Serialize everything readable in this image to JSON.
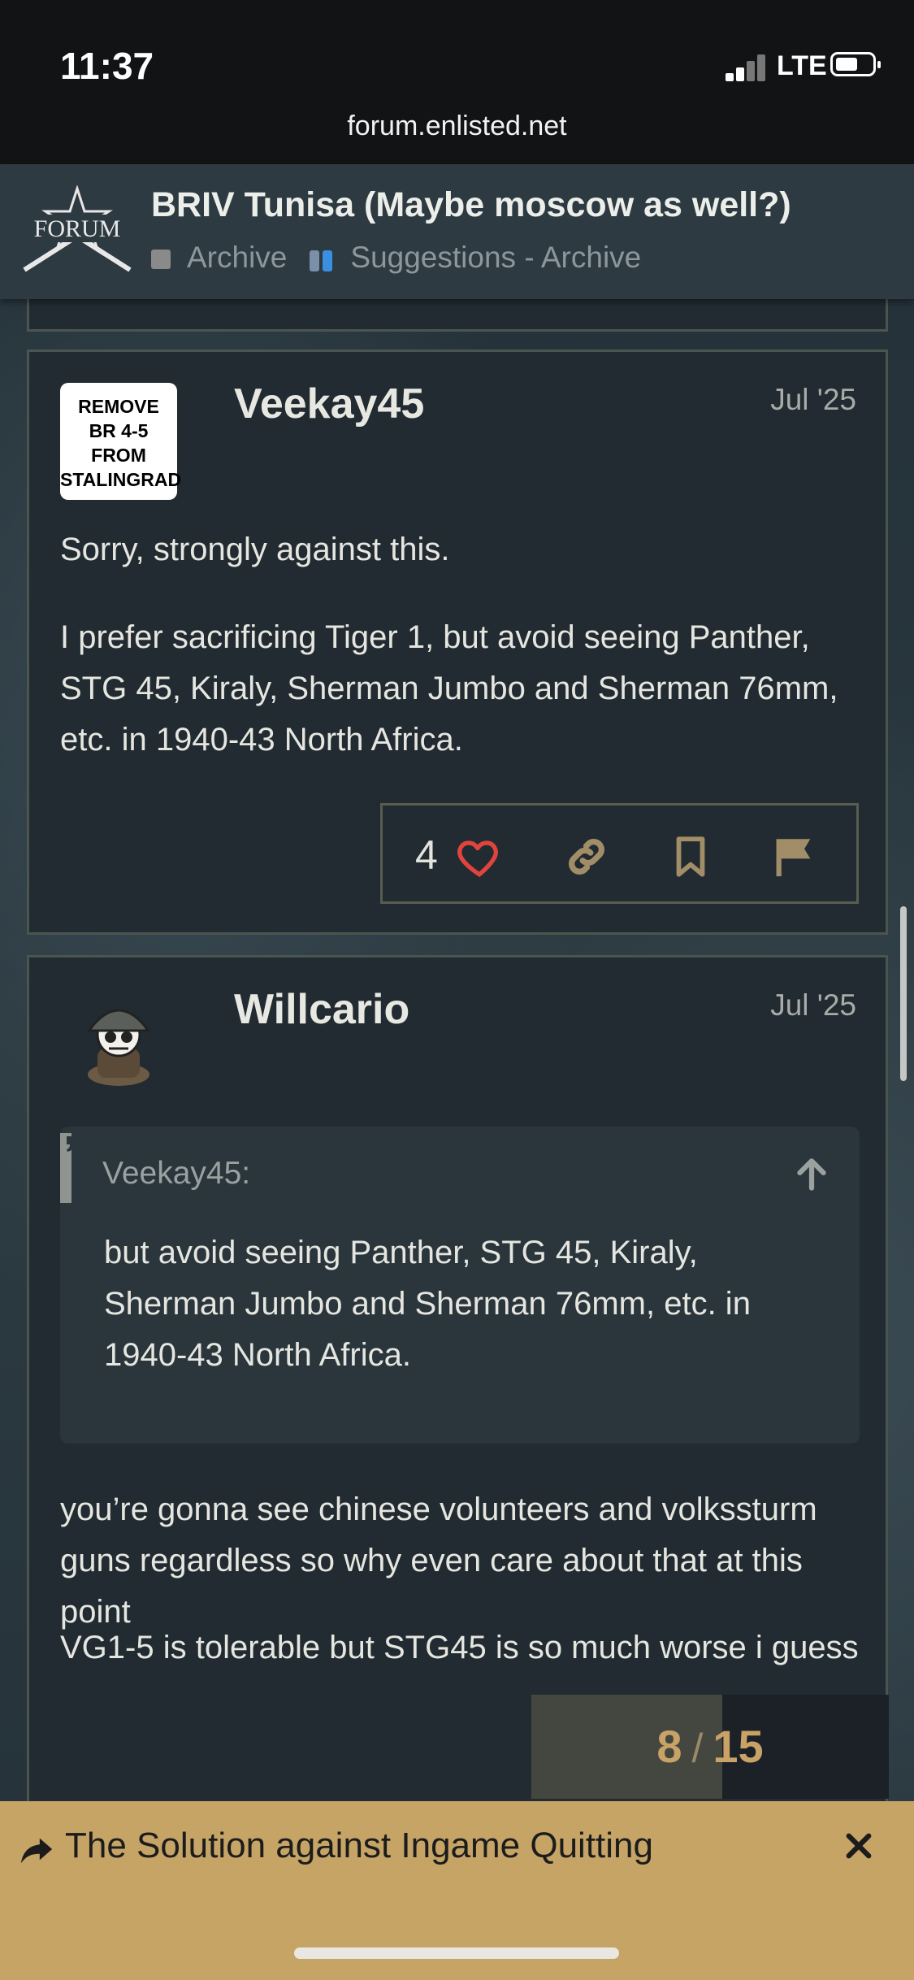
{
  "status_bar": {
    "time": "11:37",
    "network": "LTE",
    "url": "forum.enlisted.net"
  },
  "header": {
    "logo_text": "FORUM",
    "topic_title": "BRIV Tunisa (Maybe moscow as well?)",
    "category_parent": "Archive",
    "category_child": "Suggestions - Archive",
    "colors": {
      "archive": "#8a8a8a",
      "suggestions_a": "#7a8fa8",
      "suggestions_b": "#3a8fe0"
    }
  },
  "posts": [
    {
      "avatar_text": "REMOVE BR 4-5 FROM STALINGRAD",
      "avatar_lines": [
        "REMOVE",
        "BR 4-5",
        "FROM",
        "STALINGRAD"
      ],
      "author": "Veekay45",
      "date": "Jul '25",
      "paragraphs": [
        "Sorry, strongly against this.",
        "I prefer sacrificing Tiger 1, but avoid seeing Panther, STG 45, Kiraly, Sherman Jumbo and Sherman 76mm, etc. in 1940-43 North Africa."
      ],
      "like_count": "4",
      "action_icons": [
        "heart-icon",
        "link-icon",
        "bookmark-icon",
        "flag-icon"
      ]
    },
    {
      "author": "Willcario",
      "date": "Jul '25",
      "quote": {
        "author": "Veekay45:",
        "text": "but avoid seeing Panther, STG 45, Kiraly, Sherman Jumbo and Sherman 76mm, etc. in 1940-43 North Africa."
      },
      "paragraphs": [
        "you’re gonna see chinese volunteers and volkssturm guns regardless so why even care about that at this point",
        "VG1-5 is tolerable but STG45 is so much worse i guess"
      ]
    }
  ],
  "progress": {
    "current": "8",
    "separator": "/",
    "total": "15",
    "fraction": 0.533
  },
  "banner": {
    "message": "The Solution against Ingame Quitting",
    "accent": "#c6a466"
  }
}
